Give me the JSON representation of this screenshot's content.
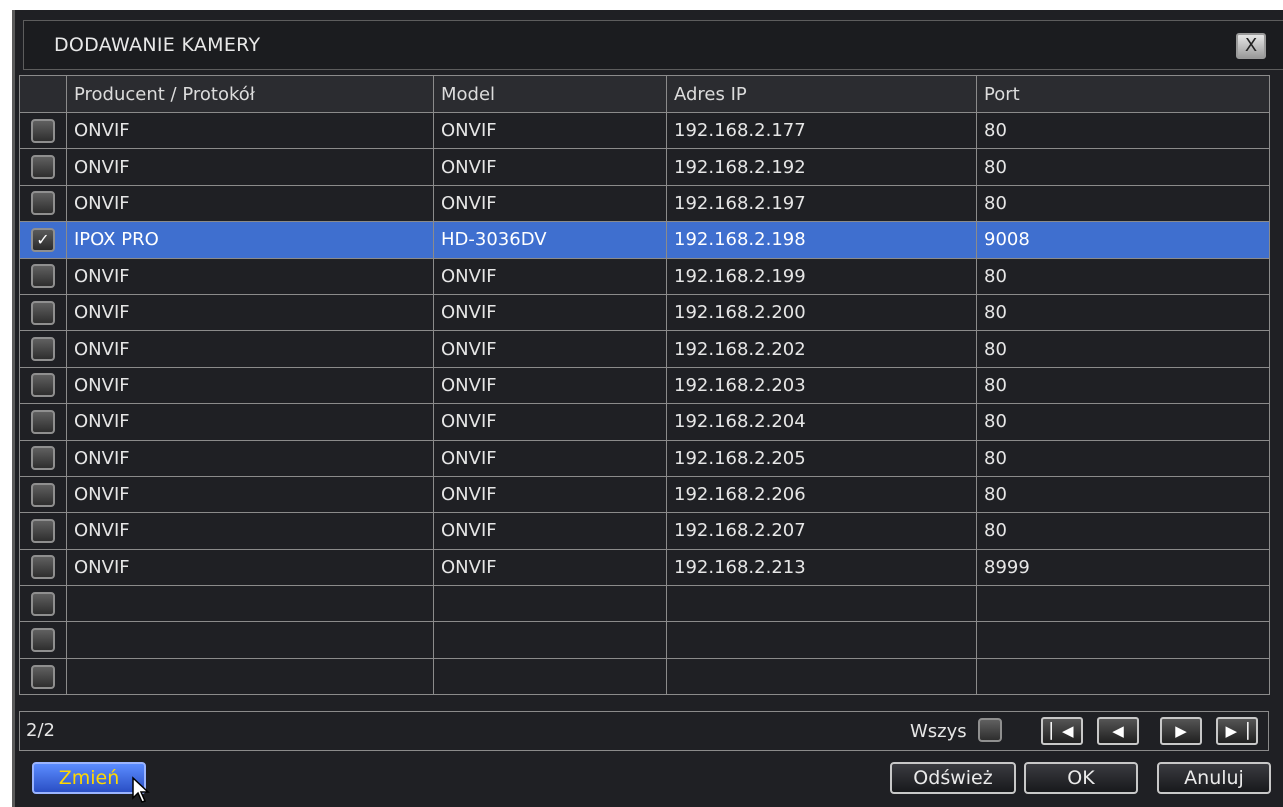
{
  "dialog": {
    "title": "DODAWANIE KAMERY",
    "close_label": "X"
  },
  "table": {
    "headers": {
      "vendor": "Producent / Protokół",
      "model": "Model",
      "ip": "Adres IP",
      "port": "Port"
    },
    "rows": [
      {
        "checked": false,
        "vendor": "ONVIF",
        "model": "ONVIF",
        "ip": "192.168.2.177",
        "port": "80"
      },
      {
        "checked": false,
        "vendor": "ONVIF",
        "model": "ONVIF",
        "ip": "192.168.2.192",
        "port": "80"
      },
      {
        "checked": false,
        "vendor": "ONVIF",
        "model": "ONVIF",
        "ip": "192.168.2.197",
        "port": "80"
      },
      {
        "checked": true,
        "vendor": "IPOX PRO",
        "model": "HD-3036DV",
        "ip": "192.168.2.198",
        "port": "9008"
      },
      {
        "checked": false,
        "vendor": "ONVIF",
        "model": "ONVIF",
        "ip": "192.168.2.199",
        "port": "80"
      },
      {
        "checked": false,
        "vendor": "ONVIF",
        "model": "ONVIF",
        "ip": "192.168.2.200",
        "port": "80"
      },
      {
        "checked": false,
        "vendor": "ONVIF",
        "model": "ONVIF",
        "ip": "192.168.2.202",
        "port": "80"
      },
      {
        "checked": false,
        "vendor": "ONVIF",
        "model": "ONVIF",
        "ip": "192.168.2.203",
        "port": "80"
      },
      {
        "checked": false,
        "vendor": "ONVIF",
        "model": "ONVIF",
        "ip": "192.168.2.204",
        "port": "80"
      },
      {
        "checked": false,
        "vendor": "ONVIF",
        "model": "ONVIF",
        "ip": "192.168.2.205",
        "port": "80"
      },
      {
        "checked": false,
        "vendor": "ONVIF",
        "model": "ONVIF",
        "ip": "192.168.2.206",
        "port": "80"
      },
      {
        "checked": false,
        "vendor": "ONVIF",
        "model": "ONVIF",
        "ip": "192.168.2.207",
        "port": "80"
      },
      {
        "checked": false,
        "vendor": "ONVIF",
        "model": "ONVIF",
        "ip": "192.168.2.213",
        "port": "8999"
      },
      {
        "checked": false,
        "vendor": "",
        "model": "",
        "ip": "",
        "port": ""
      },
      {
        "checked": false,
        "vendor": "",
        "model": "",
        "ip": "",
        "port": ""
      },
      {
        "checked": false,
        "vendor": "",
        "model": "",
        "ip": "",
        "port": ""
      }
    ],
    "selected_row": 3
  },
  "footer": {
    "page_info": "2/2",
    "select_all_label": "Wszys",
    "nav": {
      "first_icon": "skip-first-icon",
      "prev_icon": "prev-icon",
      "next_icon": "next-icon",
      "last_icon": "skip-last-icon"
    }
  },
  "buttons": {
    "change": "Zmień",
    "refresh": "Odśwież",
    "ok": "OK",
    "cancel": "Anuluj"
  },
  "colors": {
    "background": "#1f2024",
    "selected_row": "#3f6fcf",
    "primary_button": "#3f6fe0",
    "primary_text": "#ffd800"
  }
}
